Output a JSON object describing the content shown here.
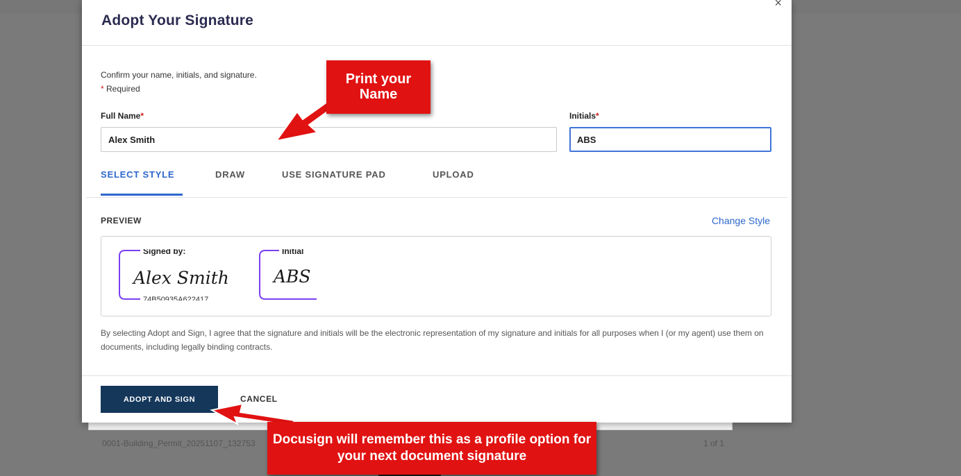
{
  "modal": {
    "title": "Adopt Your Signature",
    "close_label": "×",
    "intro": "Confirm your name, initials, and signature.",
    "required_star": "*",
    "required_note": "Required"
  },
  "form": {
    "full_name_label": "Full Name",
    "full_name_value": "Alex Smith",
    "initials_label": "Initials",
    "initials_value": "ABS"
  },
  "tabs": [
    {
      "label": "SELECT STYLE",
      "active": true
    },
    {
      "label": "DRAW",
      "active": false
    },
    {
      "label": "USE SIGNATURE PAD",
      "active": false
    },
    {
      "label": "UPLOAD",
      "active": false
    }
  ],
  "preview": {
    "label": "PREVIEW",
    "change_style": "Change Style",
    "signed_by_label": "Signed by:",
    "signature_text": "Alex Smith",
    "signature_id": "74B50935A622417...",
    "initial_label": "Initial",
    "initial_text": "ABS",
    "accent_color": "#7a3ff2"
  },
  "disclaimer": "By selecting Adopt and Sign, I agree that the signature and initials will be the electronic representation of my signature and initials for all purposes when I (or my agent) use them on documents, including legally binding contracts.",
  "actions": {
    "adopt_label": "ADOPT AND SIGN",
    "cancel_label": "CANCEL"
  },
  "background": {
    "filename": "0001-Building_Permit_20251107_132753",
    "page_count": "1 of 1"
  },
  "annotations": {
    "print_name": "Print your Name",
    "docusign_note": "Docusign will remember this as a profile option for your next document signature",
    "callout_color": "#e11212"
  }
}
